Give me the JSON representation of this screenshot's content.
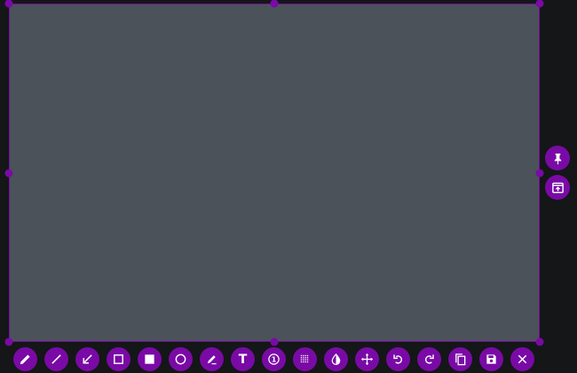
{
  "colors": {
    "accent": "#7a0aa6",
    "canvas": "#4b525a",
    "background": "#141618",
    "icon": "#ffffff"
  },
  "toolbar": {
    "tools": [
      {
        "icon": "pencil-icon"
      },
      {
        "icon": "line-icon"
      },
      {
        "icon": "arrow-icon"
      },
      {
        "icon": "rectangle-outline-icon"
      },
      {
        "icon": "rectangle-filled-icon"
      },
      {
        "icon": "circle-outline-icon"
      },
      {
        "icon": "marker-icon"
      },
      {
        "icon": "text-icon",
        "glyph": "T"
      },
      {
        "icon": "counter-icon",
        "glyph": "1"
      },
      {
        "icon": "pixelate-icon"
      },
      {
        "icon": "invert-icon"
      },
      {
        "icon": "move-icon"
      },
      {
        "icon": "undo-icon"
      },
      {
        "icon": "redo-icon"
      },
      {
        "icon": "copy-icon"
      },
      {
        "icon": "save-icon"
      },
      {
        "icon": "close-icon"
      }
    ]
  },
  "side_panel": {
    "tools": [
      {
        "icon": "pin-icon"
      },
      {
        "icon": "open-in-app-icon"
      }
    ]
  }
}
